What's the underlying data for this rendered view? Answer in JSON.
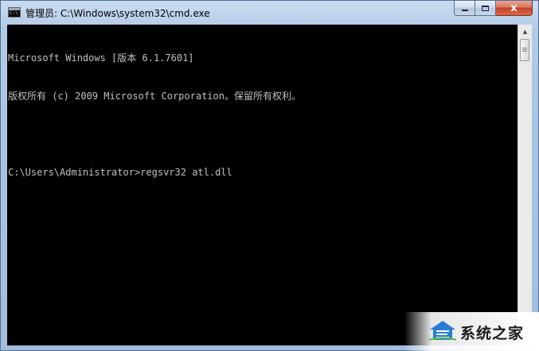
{
  "window": {
    "title": "管理员: C:\\Windows\\system32\\cmd.exe",
    "icon": "cmd-console-icon",
    "icon_text": "C:\\"
  },
  "caption_buttons": {
    "minimize": "minimize-icon",
    "maximize": "maximize-icon",
    "close_glyph": "x",
    "close_color": "#c5412a"
  },
  "console": {
    "background": "#000000",
    "foreground": "#c0c0c0",
    "lines": [
      "Microsoft Windows [版本 6.1.7601]",
      "版权所有 (c) 2009 Microsoft Corporation。保留所有权利。",
      "",
      "C:\\Users\\Administrator>regsvr32 atl.dll"
    ]
  },
  "scrollbar": {
    "up_arrow": "▲",
    "down_arrow": "▼"
  },
  "watermark": {
    "brand": "系统之家"
  }
}
